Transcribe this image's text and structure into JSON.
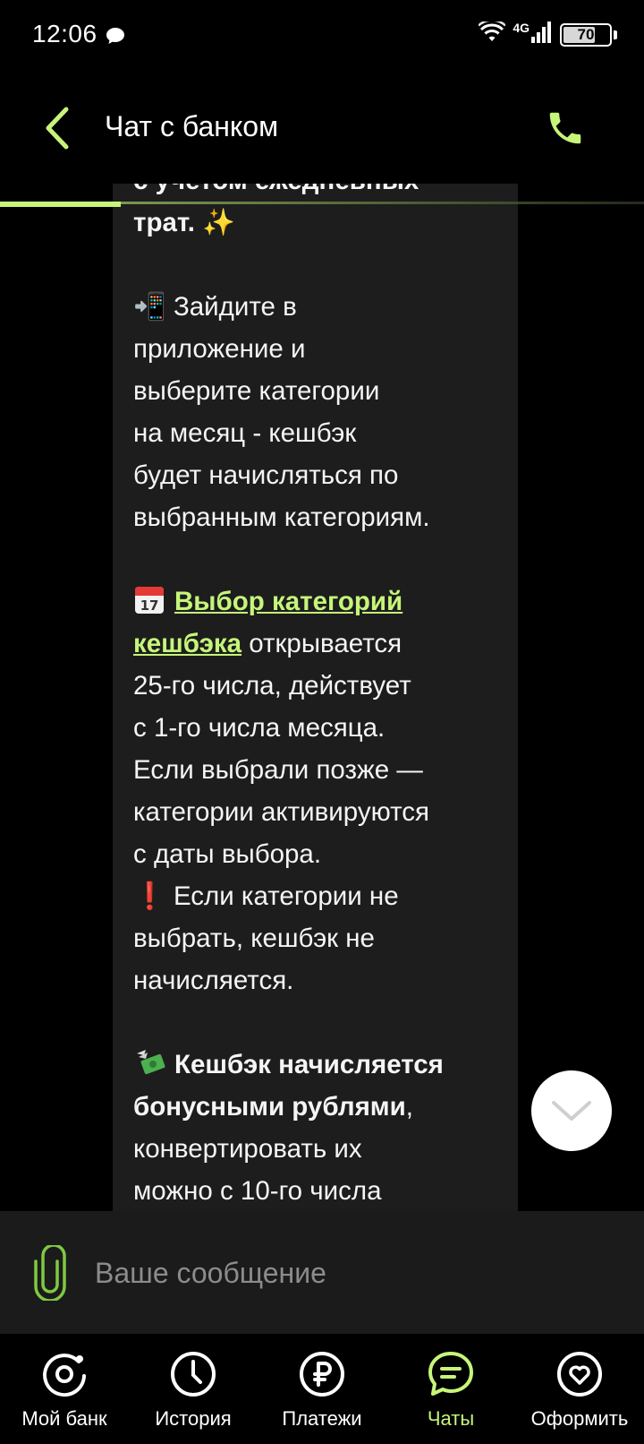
{
  "status_bar": {
    "time": "12:06",
    "network": "4G",
    "battery": "70",
    "battery_level": 0.7
  },
  "header": {
    "title": "Чат с банком",
    "back_icon": "chevron-left-icon",
    "call_icon": "phone-icon"
  },
  "colors": {
    "accent": "#c6f57a",
    "background": "#000000",
    "bubble": "#1d1d1d",
    "composer": "#1b1b1b"
  },
  "message": {
    "line1": "с учетом ежедневных",
    "line2": "трат.",
    "sparkle": "✨",
    "p2": {
      "emoji": "📲",
      "lines": [
        "Зайдите в",
        "приложение и",
        "выберите категории",
        "на месяц - кешбэк",
        "будет начисляться по",
        "выбранным категориям."
      ]
    },
    "p3": {
      "emoji_name": "calendar-icon",
      "link_line1": "Выбор категорий",
      "link_line2": "кешбэка",
      "after_link": " открывается",
      "lines": [
        "25-го числа, действует",
        "с 1-го числа месяца.",
        "Если выбрали позже —",
        "категории активируются",
        "с даты выбора."
      ],
      "warning_emoji": "❗",
      "warning_lines": [
        "Если категории не",
        "выбрать, кешбэк не",
        "начисляется."
      ]
    },
    "p4": {
      "emoji_name": "money-wings-icon",
      "bold1": "Кешбэк начисляется",
      "bold2": "бонусными рублями",
      "comma": ",",
      "line3": "конвертировать их",
      "line4": "можно с 10-го числа"
    }
  },
  "composer": {
    "placeholder": "Ваше сообщение"
  },
  "nav": {
    "items": [
      {
        "label": "Мой банк",
        "icon": "my-bank-icon"
      },
      {
        "label": "История",
        "icon": "clock-icon"
      },
      {
        "label": "Платежи",
        "icon": "ruble-icon"
      },
      {
        "label": "Чаты",
        "icon": "chat-icon",
        "active": true
      },
      {
        "label": "Оформить",
        "icon": "heart-icon"
      }
    ]
  }
}
